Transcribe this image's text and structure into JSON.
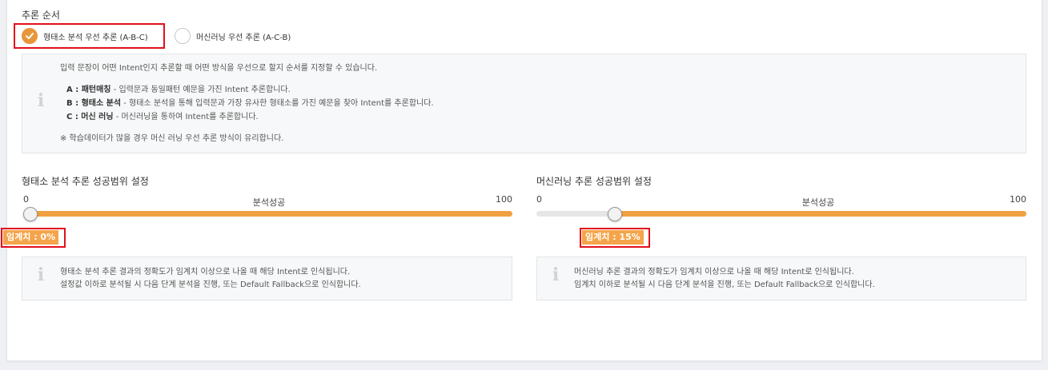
{
  "inference_order": {
    "title": "추론 순서",
    "options": [
      {
        "label": "형태소 분석 우선 추론 (A-B-C)",
        "checked": true
      },
      {
        "label": "머신러닝 우선 추론 (A-C-B)",
        "checked": false
      }
    ],
    "info": {
      "intro": "입력 문장이 어떤 Intent인지 추론할 때 어떤 방식을 우선으로 할지 순서를 지정할 수 있습니다.",
      "items": [
        {
          "key": "A : 패턴매칭",
          "desc": " - 입력문과 동일패턴 예문을 가진 Intent 추론합니다."
        },
        {
          "key": "B : 형태소 분석",
          "desc": " - 형태소 분석을 통해 입력문과 가장 유사한 형태소를 가진 예문을 찾아 Intent를 추론합니다."
        },
        {
          "key": "C : 머신 러닝",
          "desc": " - 머신러닝을 통하여 Intent를 추론합니다."
        }
      ],
      "note": "※ 학습데이터가 많을 경우 머신 러닝 우선 추론 방식이 유리합니다."
    }
  },
  "morph_range": {
    "title": "형태소 분석 추론 성공범위 설정",
    "min_label": "0",
    "max_label": "100",
    "center_label": "분석성공",
    "value_percent": 0,
    "threshold_text": "임계치 : 0%",
    "info_lines": [
      "형태소 분석 추론 결과의 정확도가 임계치 이상으로 나올 때 해당 Intent로 인식됩니다.",
      "설정값 이하로 분석될 시 다음 단계 분석을 진행, 또는 Default Fallback으로 인식합니다."
    ]
  },
  "ml_range": {
    "title": "머신러닝 추론 성공범위 설정",
    "min_label": "0",
    "max_label": "100",
    "center_label": "분석성공",
    "value_percent": 15,
    "threshold_text": "임계치 : 15%",
    "info_lines": [
      "머신러닝 추론 결과의 정확도가 임계치 이상으로 나올 때 해당 Intent로 인식됩니다.",
      "임계치 이하로 분석될 시 다음 단계 분석을 진행, 또는 Default Fallback으로 인식합니다."
    ]
  },
  "colors": {
    "accent": "#e7963a",
    "slider_fill": "#f0a040",
    "highlight": "#e2101b"
  },
  "icons": {
    "check": "check-icon",
    "info": "info-icon"
  }
}
